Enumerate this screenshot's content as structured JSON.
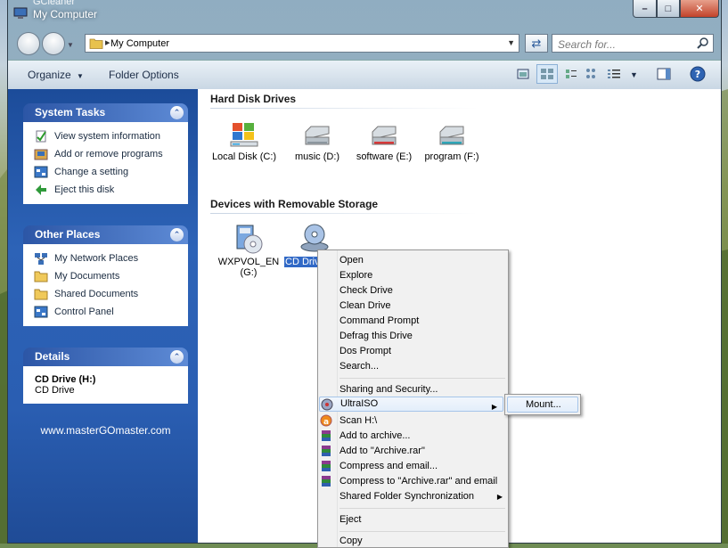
{
  "window": {
    "app_name": "GCleaner",
    "title": "My Computer",
    "caption_buttons": {
      "minimize": "–",
      "maximize": "□",
      "close": "✕"
    }
  },
  "navbar": {
    "address_path": "My Computer",
    "search_placeholder": "Search for..."
  },
  "toolbar": {
    "organize_label": "Organize",
    "folder_options_label": "Folder Options"
  },
  "left_pane": {
    "system_tasks": {
      "title": "System Tasks",
      "items": [
        {
          "label": "View system information",
          "icon": "check-document-icon"
        },
        {
          "label": "Add or remove programs",
          "icon": "programs-icon"
        },
        {
          "label": "Change a setting",
          "icon": "control-panel-icon"
        },
        {
          "label": "Eject this disk",
          "icon": "eject-icon"
        }
      ]
    },
    "other_places": {
      "title": "Other Places",
      "items": [
        {
          "label": "My Network Places",
          "icon": "network-icon"
        },
        {
          "label": "My Documents",
          "icon": "folder-icon"
        },
        {
          "label": "Shared Documents",
          "icon": "folder-icon"
        },
        {
          "label": "Control Panel",
          "icon": "control-panel-icon"
        }
      ]
    },
    "details": {
      "title": "Details",
      "name": "CD Drive (H:)",
      "type": "CD Drive"
    },
    "footer_link": "www.masterGOmaster.com"
  },
  "content": {
    "hard_disk_group": "Hard Disk Drives",
    "drives": [
      {
        "label": "Local Disk (C:)",
        "icon": "windows-drive-icon"
      },
      {
        "label": "music (D:)",
        "icon": "hard-drive-icon"
      },
      {
        "label": "software (E:)",
        "icon": "hard-drive-red-icon"
      },
      {
        "label": "program (F:)",
        "icon": "hard-drive-teal-icon"
      }
    ],
    "removable_group": "Devices with Removable Storage",
    "removable": [
      {
        "label": "WXPVOL_EN (G:)",
        "icon": "cd-install-icon"
      },
      {
        "label": "CD Drive (H:)",
        "icon": "cd-drive-icon",
        "selected": true
      }
    ]
  },
  "context_menu": {
    "items": [
      {
        "label": "Open"
      },
      {
        "label": "Explore"
      },
      {
        "label": "Check Drive"
      },
      {
        "label": "Clean Drive"
      },
      {
        "label": "Command Prompt"
      },
      {
        "label": "Defrag this Drive"
      },
      {
        "label": "Dos Prompt"
      },
      {
        "label": "Search..."
      },
      {
        "label": "Sharing and Security..."
      },
      {
        "label": "UltraISO",
        "submenu": true,
        "highlighted": true
      },
      {
        "label": "Scan H:\\"
      },
      {
        "label": "Add to archive..."
      },
      {
        "label": "Add to \"Archive.rar\""
      },
      {
        "label": "Compress and email..."
      },
      {
        "label": "Compress to \"Archive.rar\" and email"
      },
      {
        "label": "Shared Folder Synchronization",
        "submenu": true
      },
      {
        "label": "Eject"
      },
      {
        "label": "Copy"
      }
    ],
    "submenu_item": "Mount..."
  }
}
